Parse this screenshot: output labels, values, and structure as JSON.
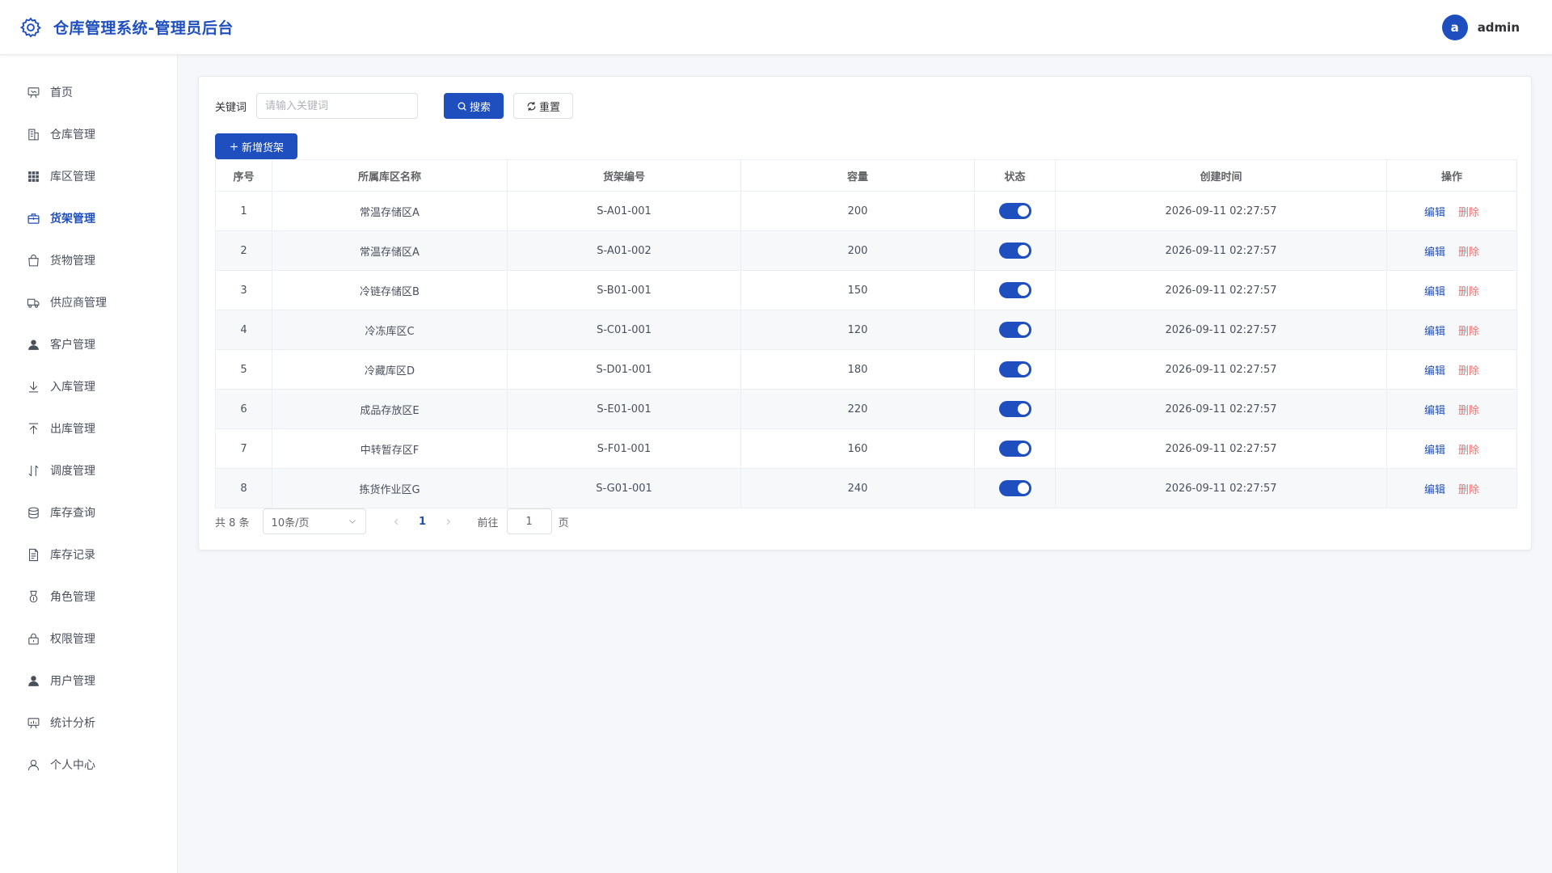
{
  "header": {
    "title": "仓库管理系统-管理员后台",
    "avatar_letter": "a",
    "username": "admin",
    "brand_color": "#1f4fbf"
  },
  "sidebar": {
    "items": [
      {
        "label": "首页",
        "icon": "presentation-board-icon",
        "active": false
      },
      {
        "label": "仓库管理",
        "icon": "office-building-icon",
        "active": false
      },
      {
        "label": "库区管理",
        "icon": "grid-icon",
        "active": false
      },
      {
        "label": "货架管理",
        "icon": "suitcase-icon",
        "active": true
      },
      {
        "label": "货物管理",
        "icon": "shopping-bag-icon",
        "active": false
      },
      {
        "label": "供应商管理",
        "icon": "truck-icon",
        "active": false
      },
      {
        "label": "客户管理",
        "icon": "user-filled-icon",
        "active": false
      },
      {
        "label": "入库管理",
        "icon": "download-icon",
        "active": false
      },
      {
        "label": "出库管理",
        "icon": "upload-icon",
        "active": false
      },
      {
        "label": "调度管理",
        "icon": "sort-icon",
        "active": false
      },
      {
        "label": "库存查询",
        "icon": "coin-stack-icon",
        "active": false
      },
      {
        "label": "库存记录",
        "icon": "document-icon",
        "active": false
      },
      {
        "label": "角色管理",
        "icon": "medal-icon",
        "active": false
      },
      {
        "label": "权限管理",
        "icon": "lock-icon",
        "active": false
      },
      {
        "label": "用户管理",
        "icon": "avatar-icon",
        "active": false
      },
      {
        "label": "统计分析",
        "icon": "data-board-icon",
        "active": false
      },
      {
        "label": "个人中心",
        "icon": "user-outline-icon",
        "active": false
      }
    ]
  },
  "search": {
    "label": "关键词",
    "placeholder": "请输入关键词",
    "search_label": "搜索",
    "reset_label": "重置"
  },
  "toolbar": {
    "add_label": "新增货架"
  },
  "table": {
    "columns": [
      "序号",
      "所属库区名称",
      "货架编号",
      "容量",
      "状态",
      "创建时间",
      "操作"
    ],
    "edit_label": "编辑",
    "delete_label": "删除",
    "rows": [
      {
        "index": "1",
        "area": "常温存储区A",
        "code": "S-A01-001",
        "capacity": "200",
        "enabled": true,
        "created": "2026-09-11 02:27:57"
      },
      {
        "index": "2",
        "area": "常温存储区A",
        "code": "S-A01-002",
        "capacity": "200",
        "enabled": true,
        "created": "2026-09-11 02:27:57"
      },
      {
        "index": "3",
        "area": "冷链存储区B",
        "code": "S-B01-001",
        "capacity": "150",
        "enabled": true,
        "created": "2026-09-11 02:27:57"
      },
      {
        "index": "4",
        "area": "冷冻库区C",
        "code": "S-C01-001",
        "capacity": "120",
        "enabled": true,
        "created": "2026-09-11 02:27:57"
      },
      {
        "index": "5",
        "area": "冷藏库区D",
        "code": "S-D01-001",
        "capacity": "180",
        "enabled": true,
        "created": "2026-09-11 02:27:57"
      },
      {
        "index": "6",
        "area": "成品存放区E",
        "code": "S-E01-001",
        "capacity": "220",
        "enabled": true,
        "created": "2026-09-11 02:27:57"
      },
      {
        "index": "7",
        "area": "中转暂存区F",
        "code": "S-F01-001",
        "capacity": "160",
        "enabled": true,
        "created": "2026-09-11 02:27:57"
      },
      {
        "index": "8",
        "area": "拣货作业区G",
        "code": "S-G01-001",
        "capacity": "240",
        "enabled": true,
        "created": "2026-09-11 02:27:57"
      }
    ]
  },
  "pagination": {
    "total_text": "共 8 条",
    "page_size": "10条/页",
    "current_page": "1",
    "goto_label": "前往",
    "goto_value": "1",
    "page_unit": "页"
  }
}
